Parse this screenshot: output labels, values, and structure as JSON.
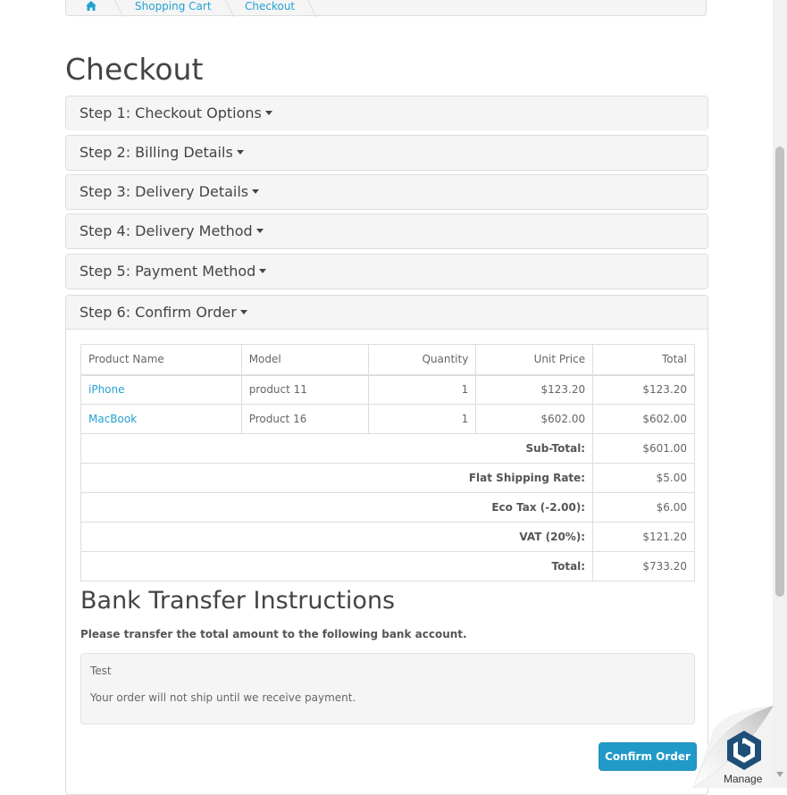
{
  "breadcrumb": {
    "items": [
      {
        "label": "Shopping Cart"
      },
      {
        "label": "Checkout"
      }
    ]
  },
  "page": {
    "title": "Checkout"
  },
  "steps": [
    {
      "label": "Step 1: Checkout Options"
    },
    {
      "label": "Step 2: Billing Details"
    },
    {
      "label": "Step 3: Delivery Details"
    },
    {
      "label": "Step 4: Delivery Method"
    },
    {
      "label": "Step 5: Payment Method"
    },
    {
      "label": "Step 6: Confirm Order"
    }
  ],
  "order_table": {
    "headers": [
      "Product Name",
      "Model",
      "Quantity",
      "Unit Price",
      "Total"
    ],
    "rows": [
      {
        "name": "iPhone",
        "model": "product 11",
        "quantity": "1",
        "unit_price": "$123.20",
        "total": "$123.20"
      },
      {
        "name": "MacBook",
        "model": "Product 16",
        "quantity": "1",
        "unit_price": "$602.00",
        "total": "$602.00"
      }
    ],
    "totals": [
      {
        "label": "Sub-Total:",
        "value": "$601.00"
      },
      {
        "label": "Flat Shipping Rate:",
        "value": "$5.00"
      },
      {
        "label": "Eco Tax (-2.00):",
        "value": "$6.00"
      },
      {
        "label": "VAT (20%):",
        "value": "$121.20"
      },
      {
        "label": "Total:",
        "value": "$733.20"
      }
    ]
  },
  "bank_transfer": {
    "title": "Bank Transfer Instructions",
    "instruction": "Please transfer the total amount to the following bank account.",
    "details": "Test",
    "note": "Your order will not ship until we receive payment."
  },
  "confirm_button": {
    "label": "Confirm Order"
  },
  "manage_widget": {
    "label": "Manage"
  },
  "colors": {
    "link": "#23a1d1",
    "button": "#229ac8",
    "manage_logo": "#1f4e79"
  }
}
